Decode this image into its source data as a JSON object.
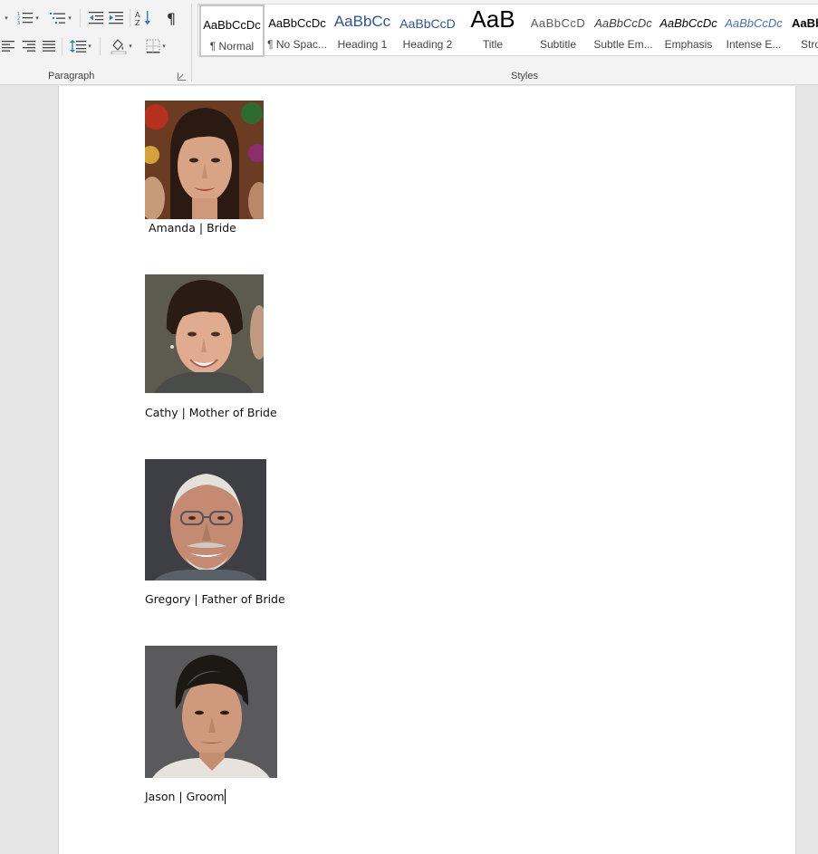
{
  "ribbon": {
    "paragraph_group_label": "Paragraph",
    "styles_group_label": "Styles",
    "styles": [
      {
        "sample": "AaBbCcDc",
        "name": "¶ Normal",
        "selected": true
      },
      {
        "sample": "AaBbCcDc",
        "name": "¶ No Spac..."
      },
      {
        "sample": "AaBbCc",
        "name": "Heading 1"
      },
      {
        "sample": "AaBbCcD",
        "name": "Heading 2"
      },
      {
        "sample": "AaB",
        "name": "Title"
      },
      {
        "sample": "AaBbCcD",
        "name": "Subtitle"
      },
      {
        "sample": "AaBbCcDc",
        "name": "Subtle Em..."
      },
      {
        "sample": "AaBbCcDc",
        "name": "Emphasis"
      },
      {
        "sample": "AaBbCcDc",
        "name": "Intense E..."
      },
      {
        "sample": "AaBbCcDc",
        "name": "Strong"
      }
    ],
    "buttons": {
      "bullets": "bullets-icon",
      "numbering": "numbering-icon",
      "multilevel": "multilevel-list-icon",
      "decrease_indent": "decrease-indent-icon",
      "increase_indent": "increase-indent-icon",
      "sort": "sort-icon",
      "show_marks": "pilcrow-icon",
      "align_left": "align-left-icon",
      "align_center": "align-center-icon",
      "align_right": "align-right-icon",
      "justify": "justify-icon",
      "line_spacing": "line-spacing-icon",
      "shading": "shading-icon",
      "borders": "borders-icon"
    },
    "colors": {
      "accent_blue": "#2b79d0",
      "heading_blue": "#2f5496"
    }
  },
  "document": {
    "entries": [
      {
        "caption": "Amanda | Bride",
        "photo": "portrait-amanda"
      },
      {
        "caption": "Cathy | Mother of Bride",
        "photo": "portrait-cathy"
      },
      {
        "caption": "Gregory | Father of Bride",
        "photo": "portrait-gregory"
      },
      {
        "caption": "Jason | Groom",
        "photo": "portrait-jason"
      }
    ]
  }
}
